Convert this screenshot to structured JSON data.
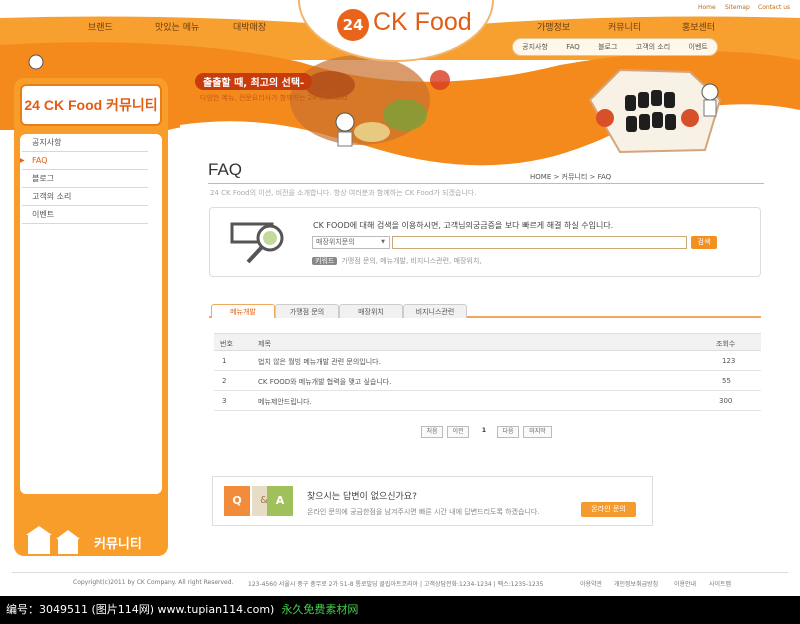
{
  "util": {
    "home": "Home",
    "sitemap": "Sitemap",
    "contact": "Contact us"
  },
  "gnav": {
    "left": [
      "브랜드",
      "맛있는 메뉴",
      "대박매장"
    ],
    "right": [
      "가맹정보",
      "커뮤니티",
      "홍보센터"
    ]
  },
  "subnav": [
    "공지사항",
    "FAQ",
    "블로그",
    "고객의 소리",
    "이벤트"
  ],
  "logo": {
    "num": "24",
    "name": "CK Food"
  },
  "slogan": {
    "main": "출출할 때, 최고의 선택-",
    "sub": "다양한 메뉴, 전문요리사가 함께하는 24 CK Food"
  },
  "sidebar": {
    "title": "24 CK Food 커뮤니티",
    "items": [
      "공지사항",
      "FAQ",
      "블로그",
      "고객의 소리",
      "이벤트"
    ]
  },
  "page": {
    "title": "FAQ",
    "breadcrumb": "HOME > 커뮤니티 > FAQ",
    "intro": "24 CK Food의 이션, 비전을 소개합니다. 항상 여러분과 함께하는 CK Food가 되겠습니다."
  },
  "search": {
    "text": "CK FOOD에 대해 검색을 이용하시면, 고객님의궁금증을 보다 빠르게 해결 하실 수입니다.",
    "select": "매장위치문의",
    "button": "검색",
    "kw_label": "키워드",
    "keywords": "가맹점 문의, 메뉴개발, 비지니스관련, 매장위치,"
  },
  "tabs": [
    "메뉴개발",
    "가맹점 문의",
    "매장위치",
    "비지니스관련"
  ],
  "table": {
    "headers": [
      "번호",
      "제목",
      "조회수"
    ],
    "rows": [
      {
        "no": "1",
        "title": "법치 않은 월빙 메뉴개발 관련 문의입니다.",
        "views": "123"
      },
      {
        "no": "2",
        "title": "CK FOOD와 메뉴개발 협력을 맺고 싶습니다.",
        "views": "55"
      },
      {
        "no": "3",
        "title": "메뉴제안드립니다.",
        "views": "300"
      }
    ]
  },
  "pagination": {
    "first": "처음",
    "prev": "이전",
    "current": "1",
    "next": "다음",
    "last": "마지막"
  },
  "qa": {
    "q": "Q",
    "amp": "&",
    "a": "A",
    "title": "찾으시는 답변이 없으신가요?",
    "desc": "온라인 문의에 궁금한점을 남겨주시면 빠른 시간 내에 답변드리도록 하겠습니다.",
    "button": "온라인 문의"
  },
  "footer": {
    "copy": "Copyright(c)2011 by CK Company. All right Reserved.",
    "address": "123-4560 서울시 중구 충무로 2가 51-8 통로빌딩 클립아트코리아 | 고객상담전화:1234-1234 | 팩스:1235-1235",
    "links": [
      "이용약관",
      "개인정보취급방침",
      "이용안내",
      "사이트맵"
    ]
  },
  "watermark": {
    "id": "编号：3049511 (图片114网) www.tupian114.com)",
    "slogan": "永久免费素材网"
  },
  "colors": {
    "accent": "#f89c2a",
    "brand": "#e25d14"
  }
}
